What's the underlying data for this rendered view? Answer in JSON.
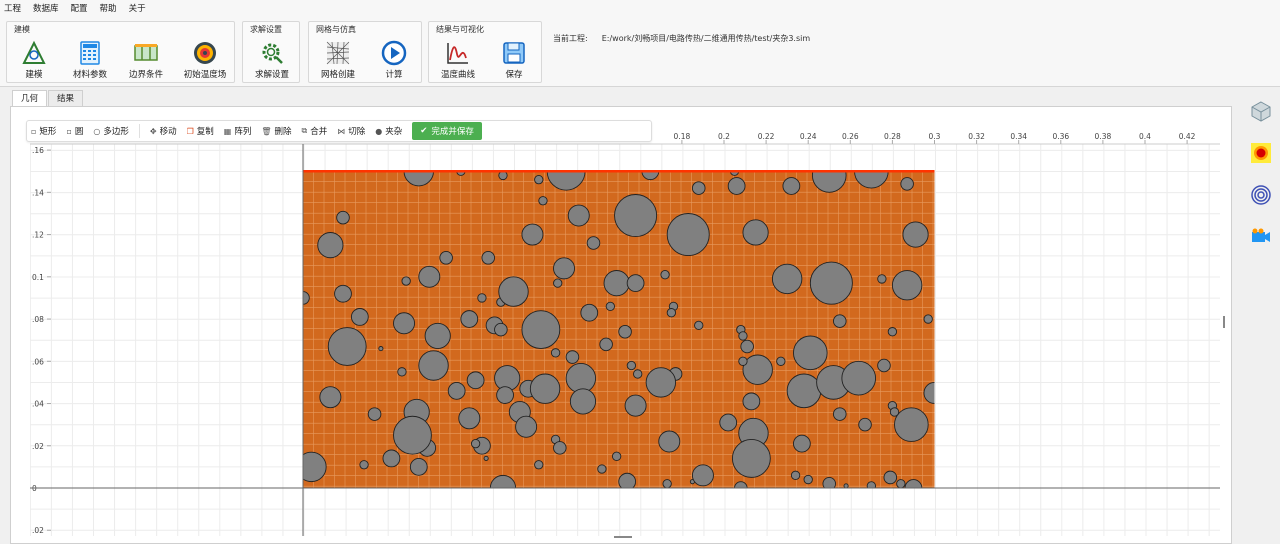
{
  "menu": [
    "工程",
    "数据库",
    "配置",
    "帮助",
    "关于"
  ],
  "ribbon": {
    "groups": [
      {
        "title": "建模",
        "buttons": [
          "建模",
          "材料参数",
          "边界条件",
          "初始温度场"
        ]
      },
      {
        "title": "求解设置",
        "buttons": [
          "求解设置"
        ]
      },
      {
        "title": "网格与仿真",
        "buttons": [
          "网格创建",
          "计算"
        ]
      },
      {
        "title": "结果与可视化",
        "buttons": [
          "温度曲线",
          "保存"
        ]
      }
    ],
    "current_project_label": "当前工程:",
    "current_project_path": "E:/work/刘畅项目/电路传热/二维通用传热/test/夹杂3.sim"
  },
  "tabs": [
    "几何",
    "结果"
  ],
  "active_tab": "几何",
  "toolbar": {
    "rect": "矩形",
    "circle": "圆",
    "polygon": "多边形",
    "move": "移动",
    "copy": "复制",
    "array": "阵列",
    "delete": "删除",
    "merge": "合并",
    "cut": "切除",
    "inclusion": "夹杂",
    "finish": "完成并保存"
  },
  "right_icons": [
    "cube-icon",
    "heat-icon",
    "contour-icon",
    "video-icon"
  ],
  "colors": {
    "matrix": "#d2691e",
    "inclusion": "#808080",
    "top_edge": "#ff3300",
    "finish": "#4caf50"
  },
  "plot": {
    "x_ticks": [
      "0.18",
      "0.2",
      "0.22",
      "0.24",
      "0.26",
      "0.28",
      "0.3",
      "0.32",
      "0.34",
      "0.36",
      "0.38",
      "0.4",
      "0.42"
    ],
    "y_ticks": [
      ".16",
      ".14",
      ".12",
      "0.1",
      ".08",
      ".06",
      ".04",
      ".02",
      "0",
      ".02"
    ],
    "domain": {
      "x": [
        0,
        0.3
      ],
      "y": [
        0,
        0.15
      ]
    }
  },
  "inclusions": [
    [
      0.055,
      0.15,
      0.007
    ],
    [
      0.125,
      0.15,
      0.009
    ],
    [
      0.165,
      0.15,
      0.004
    ],
    [
      0.205,
      0.15,
      0.002
    ],
    [
      0.25,
      0.148,
      0.008
    ],
    [
      0.27,
      0.15,
      0.008
    ],
    [
      0.075,
      0.15,
      0.002
    ],
    [
      0.078,
      0.151,
      0.001
    ],
    [
      0.095,
      0.148,
      0.002
    ],
    [
      0.112,
      0.146,
      0.002
    ],
    [
      0.188,
      0.142,
      0.003
    ],
    [
      0.206,
      0.143,
      0.004
    ],
    [
      0.232,
      0.143,
      0.004
    ],
    [
      0.287,
      0.144,
      0.003
    ],
    [
      0.114,
      0.136,
      0.002
    ],
    [
      0.131,
      0.129,
      0.005
    ],
    [
      0.158,
      0.129,
      0.01
    ],
    [
      0.183,
      0.12,
      0.01
    ],
    [
      0.019,
      0.128,
      0.003
    ],
    [
      0.013,
      0.115,
      0.006
    ],
    [
      0.109,
      0.12,
      0.005
    ],
    [
      0.138,
      0.116,
      0.003
    ],
    [
      0.215,
      0.121,
      0.006
    ],
    [
      0.291,
      0.12,
      0.006
    ],
    [
      0.068,
      0.109,
      0.003
    ],
    [
      0.088,
      0.109,
      0.003
    ],
    [
      0.06,
      0.1,
      0.005
    ],
    [
      0.049,
      0.098,
      0.002
    ],
    [
      0.124,
      0.104,
      0.005
    ],
    [
      0.149,
      0.097,
      0.006
    ],
    [
      0.158,
      0.097,
      0.004
    ],
    [
      0.096,
      0.095,
      0.002
    ],
    [
      0.094,
      0.088,
      0.002
    ],
    [
      0.096,
      0.093,
      0.002
    ],
    [
      0.048,
      0.078,
      0.005
    ],
    [
      0.085,
      0.09,
      0.002
    ],
    [
      0.121,
      0.097,
      0.002
    ],
    [
      0.172,
      0.101,
      0.002
    ],
    [
      0.23,
      0.099,
      0.007
    ],
    [
      0.251,
      0.097,
      0.01
    ],
    [
      0.275,
      0.099,
      0.002
    ],
    [
      0.287,
      0.096,
      0.007
    ],
    [
      0.019,
      0.092,
      0.004
    ],
    [
      0.1,
      0.093,
      0.007
    ],
    [
      0.0,
      0.09,
      0.003
    ],
    [
      0.026,
      0.08,
      0.002
    ],
    [
      0.079,
      0.08,
      0.004
    ],
    [
      0.091,
      0.077,
      0.004
    ],
    [
      0.146,
      0.086,
      0.002
    ],
    [
      0.136,
      0.083,
      0.004
    ],
    [
      0.176,
      0.086,
      0.002
    ],
    [
      0.175,
      0.083,
      0.002
    ],
    [
      0.094,
      0.075,
      0.003
    ],
    [
      0.027,
      0.081,
      0.004
    ],
    [
      0.064,
      0.072,
      0.006
    ],
    [
      0.113,
      0.075,
      0.009
    ],
    [
      0.153,
      0.074,
      0.003
    ],
    [
      0.188,
      0.077,
      0.002
    ],
    [
      0.208,
      0.075,
      0.002
    ],
    [
      0.211,
      0.067,
      0.003
    ],
    [
      0.037,
      0.066,
      0.001
    ],
    [
      0.021,
      0.067,
      0.009
    ],
    [
      0.144,
      0.068,
      0.003
    ],
    [
      0.209,
      0.072,
      0.002
    ],
    [
      0.255,
      0.079,
      0.003
    ],
    [
      0.28,
      0.074,
      0.002
    ],
    [
      0.216,
      0.056,
      0.007
    ],
    [
      0.227,
      0.06,
      0.002
    ],
    [
      0.209,
      0.06,
      0.002
    ],
    [
      0.241,
      0.064,
      0.008
    ],
    [
      0.276,
      0.058,
      0.003
    ],
    [
      0.128,
      0.062,
      0.003
    ],
    [
      0.047,
      0.055,
      0.002
    ],
    [
      0.062,
      0.058,
      0.007
    ],
    [
      0.12,
      0.064,
      0.002
    ],
    [
      0.177,
      0.054,
      0.003
    ],
    [
      0.159,
      0.054,
      0.002
    ],
    [
      0.17,
      0.05,
      0.007
    ],
    [
      0.213,
      0.041,
      0.004
    ],
    [
      0.238,
      0.046,
      0.008
    ],
    [
      0.252,
      0.05,
      0.008
    ],
    [
      0.264,
      0.052,
      0.008
    ],
    [
      0.082,
      0.051,
      0.004
    ],
    [
      0.156,
      0.058,
      0.002
    ],
    [
      0.132,
      0.052,
      0.007
    ],
    [
      0.107,
      0.047,
      0.004
    ],
    [
      0.097,
      0.052,
      0.006
    ],
    [
      0.073,
      0.046,
      0.004
    ],
    [
      0.115,
      0.047,
      0.007
    ],
    [
      0.096,
      0.044,
      0.004
    ],
    [
      0.28,
      0.039,
      0.002
    ],
    [
      0.289,
      0.03,
      0.008
    ],
    [
      0.013,
      0.043,
      0.005
    ],
    [
      0.054,
      0.036,
      0.006
    ],
    [
      0.034,
      0.035,
      0.003
    ],
    [
      0.079,
      0.033,
      0.005
    ],
    [
      0.103,
      0.036,
      0.005
    ],
    [
      0.133,
      0.041,
      0.006
    ],
    [
      0.158,
      0.039,
      0.005
    ],
    [
      0.255,
      0.035,
      0.003
    ],
    [
      0.281,
      0.036,
      0.002
    ],
    [
      0.267,
      0.03,
      0.003
    ],
    [
      0.085,
      0.02,
      0.004
    ],
    [
      0.106,
      0.029,
      0.005
    ],
    [
      0.12,
      0.023,
      0.002
    ],
    [
      0.174,
      0.022,
      0.005
    ],
    [
      0.122,
      0.019,
      0.003
    ],
    [
      0.149,
      0.015,
      0.002
    ],
    [
      0.214,
      0.026,
      0.007
    ],
    [
      0.237,
      0.021,
      0.004
    ],
    [
      0.202,
      0.031,
      0.004
    ],
    [
      0.059,
      0.019,
      0.004
    ],
    [
      0.042,
      0.014,
      0.004
    ],
    [
      0.082,
      0.021,
      0.002
    ],
    [
      0.052,
      0.025,
      0.009
    ],
    [
      0.004,
      0.01,
      0.007
    ],
    [
      0.029,
      0.011,
      0.002
    ],
    [
      0.055,
      0.01,
      0.004
    ],
    [
      0.087,
      0.014,
      0.001
    ],
    [
      0.112,
      0.011,
      0.002
    ],
    [
      0.142,
      0.009,
      0.002
    ],
    [
      0.154,
      0.003,
      0.004
    ],
    [
      0.185,
      0.003,
      0.001
    ],
    [
      0.19,
      0.006,
      0.005
    ],
    [
      0.213,
      0.014,
      0.009
    ],
    [
      0.234,
      0.006,
      0.002
    ],
    [
      0.25,
      0.002,
      0.003
    ],
    [
      0.27,
      0.001,
      0.002
    ],
    [
      0.279,
      0.005,
      0.003
    ],
    [
      0.29,
      0.0,
      0.004
    ],
    [
      0.095,
      0.0,
      0.006
    ],
    [
      0.173,
      0.002,
      0.002
    ],
    [
      0.208,
      0.0,
      0.003
    ],
    [
      0.24,
      0.004,
      0.002
    ],
    [
      0.258,
      0.001,
      0.001
    ],
    [
      0.284,
      0.002,
      0.002
    ],
    [
      0.3,
      0.045,
      0.005
    ],
    [
      0.297,
      0.08,
      0.002
    ]
  ]
}
